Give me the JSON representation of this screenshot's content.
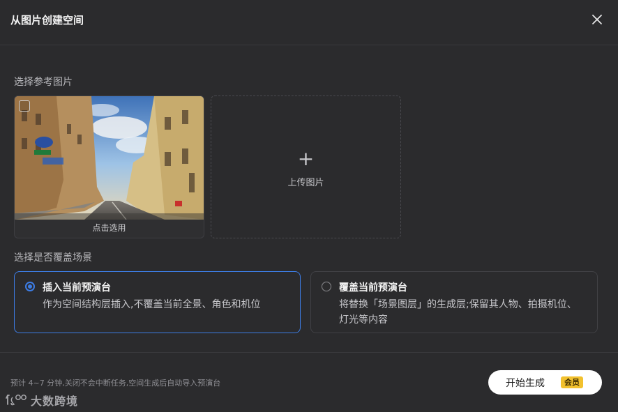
{
  "dialog": {
    "title": "从图片创建空间",
    "close_icon": "close-icon"
  },
  "reference": {
    "label": "选择参考图片",
    "image_card": {
      "caption": "点击选用",
      "checked": false
    },
    "upload": {
      "icon": "plus-icon",
      "label": "上传图片"
    }
  },
  "scene": {
    "label": "选择是否覆盖场景",
    "options": [
      {
        "title": "插入当前预演台",
        "desc": "作为空间结构层插入,不覆盖当前全景、角色和机位",
        "selected": true
      },
      {
        "title": "覆盖当前预演台",
        "desc": "将替换「场景图层」的生成层;保留其人物、拍摄机位、灯光等内容",
        "selected": false
      }
    ]
  },
  "footer": {
    "hint": "预计 4~7 分钟,关闭不会中断任务,空间生成后自动导入预演台",
    "start_button": "开始生成",
    "badge": "会员"
  },
  "watermark": {
    "text": "大数跨境"
  },
  "colors": {
    "accent": "#3d7de6",
    "background": "#2b2b2d",
    "badge": "#f2c12e"
  }
}
